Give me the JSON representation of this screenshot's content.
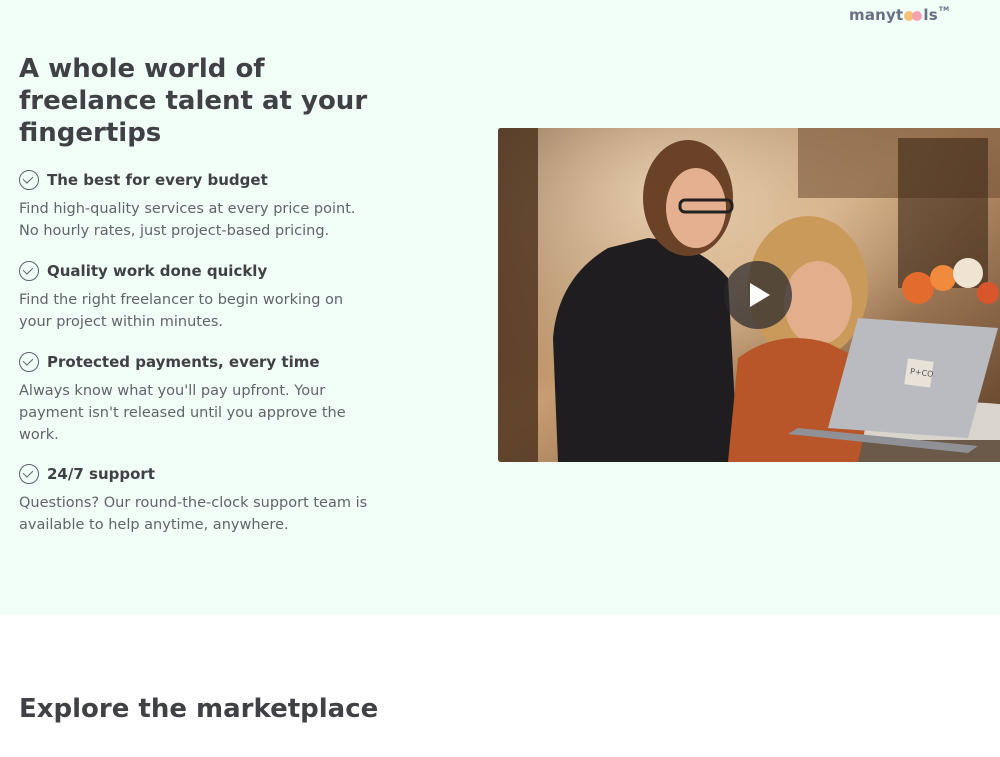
{
  "logo": {
    "text_before": "manyt",
    "text_after": "ls",
    "trademark": "TM"
  },
  "hero": {
    "title": "A whole world of freelance talent at your fingertips",
    "features": [
      {
        "title": "The best for every budget",
        "description": "Find high-quality services at every price point. No hourly rates, just project-based pricing."
      },
      {
        "title": "Quality work done quickly",
        "description": "Find the right freelancer to begin working on your project within minutes."
      },
      {
        "title": "Protected payments, every time",
        "description": "Always know what you'll pay upfront. Your payment isn't released until you approve the work."
      },
      {
        "title": "24/7 support",
        "description": "Questions? Our round-the-clock support team is available to help anytime, anywhere."
      }
    ],
    "video": {
      "laptop_sticker": "P+CO",
      "play_icon": "play-icon"
    }
  },
  "explore": {
    "heading": "Explore the marketplace"
  },
  "colors": {
    "hero_bg": "#f1fdf7",
    "heading": "#404145",
    "body_text": "#62646a",
    "logo": "#6b6f86"
  }
}
